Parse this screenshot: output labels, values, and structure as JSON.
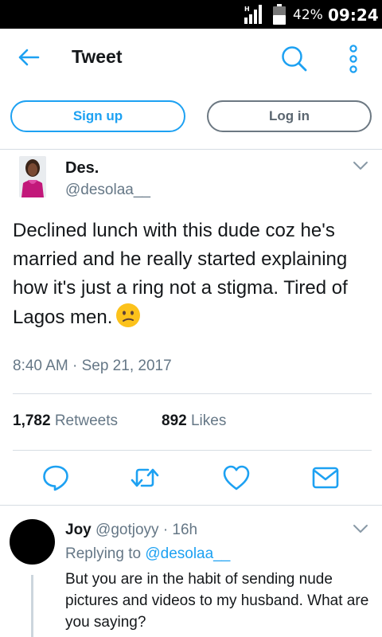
{
  "status_bar": {
    "network_type": "H",
    "battery_percent": "42%",
    "time": "09:24"
  },
  "header": {
    "title": "Tweet",
    "accent_color": "#1da1f2"
  },
  "auth": {
    "signup_label": "Sign up",
    "login_label": "Log in"
  },
  "tweet": {
    "author_name": "Des.",
    "author_handle": "@desolaa__",
    "text": "Declined lunch with this dude coz he's married and he really started explaining how it's just a ring not a stigma. Tired of Lagos men.",
    "emoji": "confused-face",
    "timestamp": "8:40 AM · Sep 21, 2017",
    "retweets_count": "1,782",
    "retweets_label": "Retweets",
    "likes_count": "892",
    "likes_label": "Likes"
  },
  "actions": [
    "reply-icon",
    "retweet-icon",
    "like-icon",
    "message-icon"
  ],
  "reply": {
    "author_name": "Joy",
    "author_handle": "@gotjoyy",
    "separator": "·",
    "age": "16h",
    "replying_to_label": "Replying to",
    "replying_to_handle": "@desolaa__",
    "text": "But you are in the habit of sending nude pictures and videos to my husband. What are you saying?"
  }
}
